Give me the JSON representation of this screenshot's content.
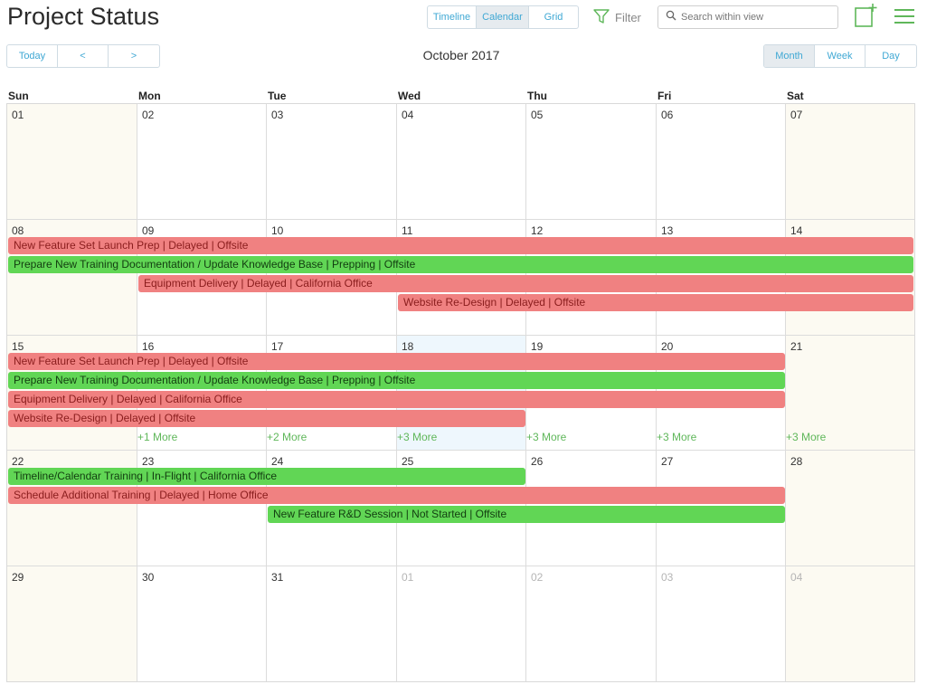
{
  "header": {
    "title": "Project Status",
    "view_tabs": [
      "Timeline",
      "Calendar",
      "Grid"
    ],
    "active_view": "Calendar",
    "filter_label": "Filter",
    "search_placeholder": "Search within view"
  },
  "nav": {
    "today": "Today",
    "prev": "<",
    "next": ">",
    "month_label": "October 2017"
  },
  "range": {
    "options": [
      "Month",
      "Week",
      "Day"
    ],
    "active": "Month"
  },
  "weekdays": [
    "Sun",
    "Mon",
    "Tue",
    "Wed",
    "Thu",
    "Fri",
    "Sat"
  ],
  "weeks": [
    [
      "01",
      "02",
      "03",
      "04",
      "05",
      "06",
      "07"
    ],
    [
      "08",
      "09",
      "10",
      "11",
      "12",
      "13",
      "14"
    ],
    [
      "15",
      "16",
      "17",
      "18",
      "19",
      "20",
      "21"
    ],
    [
      "22",
      "23",
      "24",
      "25",
      "26",
      "27",
      "28"
    ],
    [
      "29",
      "30",
      "31",
      "01",
      "02",
      "03",
      "04"
    ]
  ],
  "today_cell": {
    "week": 2,
    "day": 3
  },
  "events": [
    {
      "week": 1,
      "start": 0,
      "span": 7,
      "row": 0,
      "status": "delayed",
      "label": "New Feature Set Launch Prep | Delayed | Offsite"
    },
    {
      "week": 1,
      "start": 0,
      "span": 7,
      "row": 1,
      "status": "ok",
      "label": "Prepare New Training Documentation / Update Knowledge Base | Prepping | Offsite"
    },
    {
      "week": 1,
      "start": 1,
      "span": 6,
      "row": 2,
      "status": "delayed",
      "label": "Equipment Delivery | Delayed | California Office"
    },
    {
      "week": 1,
      "start": 3,
      "span": 4,
      "row": 3,
      "status": "delayed",
      "label": "Website Re-Design | Delayed | Offsite"
    },
    {
      "week": 2,
      "start": 0,
      "span": 6,
      "row": 0,
      "status": "delayed",
      "label": "New Feature Set Launch Prep | Delayed | Offsite"
    },
    {
      "week": 2,
      "start": 0,
      "span": 6,
      "row": 1,
      "status": "ok",
      "label": "Prepare New Training Documentation / Update Knowledge Base | Prepping | Offsite"
    },
    {
      "week": 2,
      "start": 0,
      "span": 6,
      "row": 2,
      "status": "delayed",
      "label": "Equipment Delivery | Delayed | California Office"
    },
    {
      "week": 2,
      "start": 0,
      "span": 4,
      "row": 3,
      "status": "delayed",
      "label": "Website Re-Design | Delayed | Offsite"
    },
    {
      "week": 3,
      "start": 0,
      "span": 4,
      "row": 0,
      "status": "ok",
      "label": "Timeline/Calendar Training | In-Flight | California Office"
    },
    {
      "week": 3,
      "start": 0,
      "span": 6,
      "row": 1,
      "status": "delayed",
      "label": "Schedule Additional Training | Delayed | Home Office"
    },
    {
      "week": 3,
      "start": 2,
      "span": 4,
      "row": 2,
      "status": "ok",
      "label": "New Feature R&D Session | Not Started | Offsite"
    }
  ],
  "more_links": [
    {
      "week": 2,
      "day": 1,
      "label": "+1 More"
    },
    {
      "week": 2,
      "day": 2,
      "label": "+2 More"
    },
    {
      "week": 2,
      "day": 3,
      "label": "+3 More"
    },
    {
      "week": 2,
      "day": 4,
      "label": "+3 More"
    },
    {
      "week": 2,
      "day": 5,
      "label": "+3 More"
    },
    {
      "week": 2,
      "day": 6,
      "label": "+3 More"
    }
  ],
  "colors": {
    "delayed": "#f08181",
    "ok": "#61d655",
    "accent": "#3fa8d4",
    "more": "#5fb75a"
  }
}
